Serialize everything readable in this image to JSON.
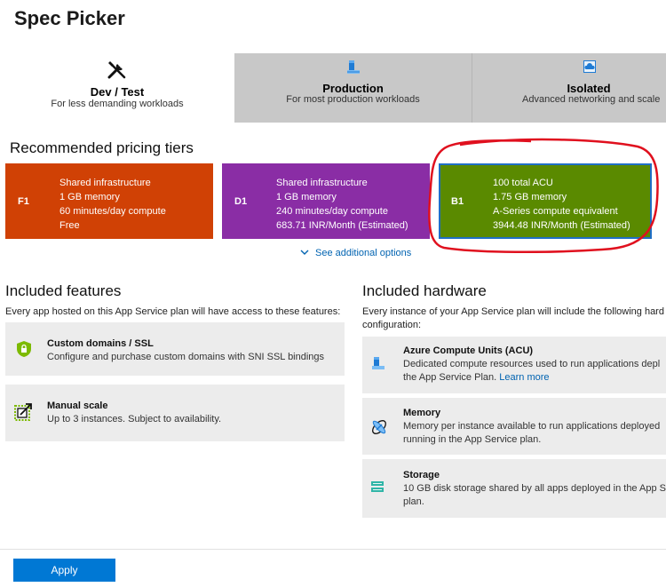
{
  "page": {
    "title": "Spec Picker"
  },
  "tabs": [
    {
      "title": "Dev / Test",
      "subtitle": "For less demanding workloads",
      "icon": "tools-icon",
      "selected": true
    },
    {
      "title": "Production",
      "subtitle": "For most production workloads",
      "icon": "server-icon",
      "selected": false
    },
    {
      "title": "Isolated",
      "subtitle": "Advanced networking and scale",
      "icon": "cloud-icon",
      "selected": false
    }
  ],
  "recommended": {
    "heading": "Recommended pricing tiers",
    "tiers": [
      {
        "code": "F1",
        "color": "#d04105",
        "lines": [
          "Shared infrastructure",
          "1 GB memory",
          "60 minutes/day compute",
          "Free"
        ]
      },
      {
        "code": "D1",
        "color": "#8a2da5",
        "lines": [
          "Shared infrastructure",
          "1 GB memory",
          "240 minutes/day compute",
          "683.71 INR/Month (Estimated)"
        ]
      },
      {
        "code": "B1",
        "color": "#5a8a00",
        "selected": true,
        "lines": [
          "100 total ACU",
          "1.75 GB memory",
          "A-Series compute equivalent",
          "3944.48 INR/Month (Estimated)"
        ]
      }
    ],
    "see_more": "See additional options"
  },
  "features": {
    "heading": "Included features",
    "description": "Every app hosted on this App Service plan will have access to these features:",
    "items": [
      {
        "title": "Custom domains / SSL",
        "text": "Configure and purchase custom domains with SNI SSL bindings",
        "icon": "shield-lock-icon"
      },
      {
        "title": "Manual scale",
        "text": "Up to 3 instances. Subject to availability.",
        "icon": "scale-icon"
      }
    ]
  },
  "hardware": {
    "heading": "Included hardware",
    "description_line1": "Every instance of your App Service plan will include the following hard",
    "description_line2": "configuration:",
    "items": [
      {
        "title": "Azure Compute Units (ACU)",
        "line1": "Dedicated compute resources used to run applications depl",
        "line2": "the App Service Plan.",
        "link": "Learn more",
        "icon": "compute-icon"
      },
      {
        "title": "Memory",
        "line1": "Memory per instance available to run applications deployed",
        "line2": "running in the App Service plan.",
        "icon": "memory-icon"
      },
      {
        "title": "Storage",
        "line1": "10 GB disk storage shared by all apps deployed in the App S",
        "line2": "plan.",
        "icon": "storage-icon"
      }
    ]
  },
  "footer": {
    "apply_label": "Apply"
  },
  "colors": {
    "accent": "#0078d4",
    "link": "#0063b1",
    "annotation": "#e0101e"
  }
}
